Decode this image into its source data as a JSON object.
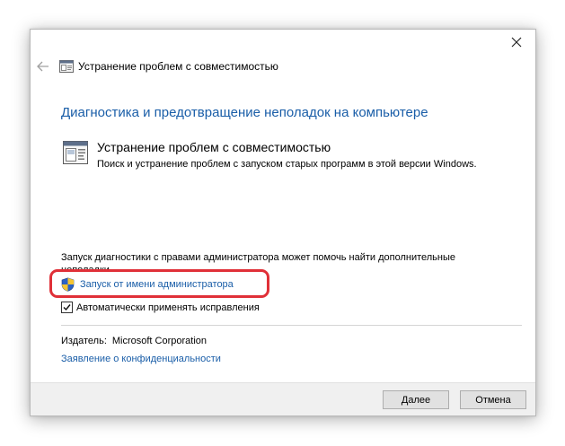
{
  "window": {
    "title": "Устранение проблем с совместимостью"
  },
  "main": {
    "heading": "Диагностика и предотвращение неполадок на компьютере",
    "tool_title": "Устранение проблем с совместимостью",
    "tool_description": "Поиск и устранение проблем с запуском старых программ в этой версии Windows.",
    "admin_info_line1": "Запуск диагностики с правами администратора может помочь найти дополнительные",
    "admin_info_line2": "неполадки.",
    "admin_link": "Запуск от имени администратора",
    "auto_fix_label": "Автоматически применять исправления",
    "auto_fix_checked": true,
    "publisher_label": "Издатель:",
    "publisher_value": "Microsoft Corporation",
    "privacy_link": "Заявление о конфиденциальности"
  },
  "footer": {
    "next_label": "Далее",
    "cancel_label": "Отмена"
  },
  "colors": {
    "link": "#1a5ea8",
    "highlight": "#e03038"
  }
}
